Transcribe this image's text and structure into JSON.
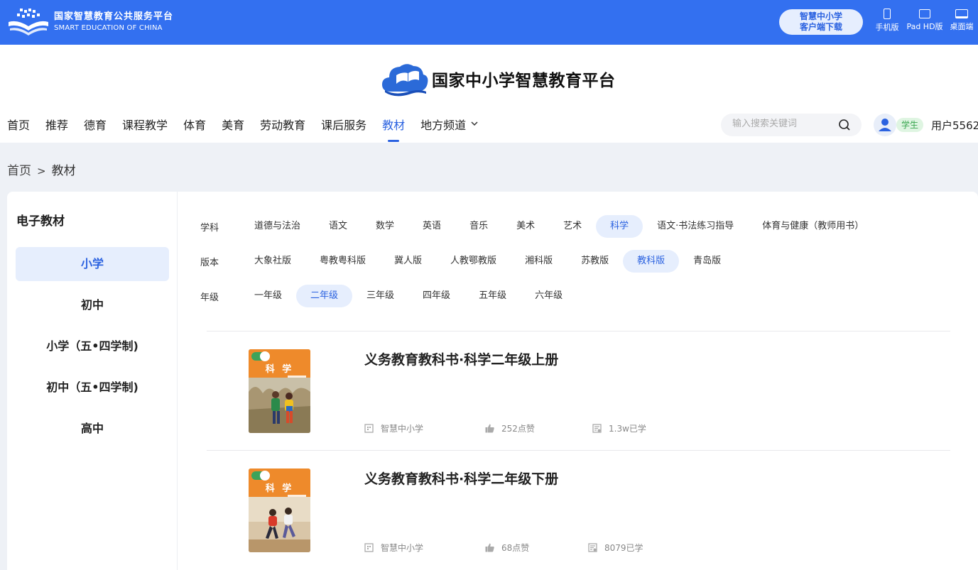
{
  "brand": {
    "name_cn": "国家智慧教育公共服务平台",
    "name_en": "SMART EDUCATION OF CHINA"
  },
  "topbar": {
    "download_line1": "智慧中小学",
    "download_line2": "客户端下载",
    "devices": [
      {
        "label": "手机版",
        "icon": "phone-icon"
      },
      {
        "label": "Pad HD版",
        "icon": "tablet-icon"
      },
      {
        "label": "桌面端",
        "icon": "desktop-icon"
      }
    ]
  },
  "site": {
    "title": "国家中小学智慧教育平台"
  },
  "nav": {
    "items": [
      {
        "label": "首页"
      },
      {
        "label": "推荐"
      },
      {
        "label": "德育"
      },
      {
        "label": "课程教学"
      },
      {
        "label": "体育"
      },
      {
        "label": "美育"
      },
      {
        "label": "劳动教育"
      },
      {
        "label": "课后服务"
      },
      {
        "label": "教材",
        "active": true
      },
      {
        "label": "地方频道"
      }
    ],
    "active_index": 8
  },
  "search": {
    "placeholder": "输入搜索关键词",
    "icon": "search-icon"
  },
  "user": {
    "role": "学生",
    "name": "用户5562"
  },
  "breadcrumb": {
    "home": "首页",
    "separator": ">",
    "current": "教材"
  },
  "sidebar": {
    "title": "电子教材",
    "items": [
      {
        "label": "小学",
        "active": true
      },
      {
        "label": "初中"
      },
      {
        "label": "小学（五•四学制)"
      },
      {
        "label": "初中（五•四学制)"
      },
      {
        "label": "高中"
      }
    ]
  },
  "filters": {
    "subject": {
      "label": "学科",
      "options": [
        "道德与法治",
        "语文",
        "数学",
        "英语",
        "音乐",
        "美术",
        "艺术",
        "科学",
        "语文·书法练习指导",
        "体育与健康（教师用书）"
      ],
      "selected": "科学"
    },
    "edition": {
      "label": "版本",
      "options": [
        "大象社版",
        "粤教粤科版",
        "冀人版",
        "人教鄂教版",
        "湘科版",
        "苏教版",
        "教科版",
        "青岛版"
      ],
      "selected": "教科版"
    },
    "grade": {
      "label": "年级",
      "options": [
        "一年级",
        "二年级",
        "三年级",
        "四年级",
        "五年级",
        "六年级"
      ],
      "selected": "二年级"
    }
  },
  "books": [
    {
      "title": "义务教育教科书·科学二年级上册",
      "cover_subject": "科 学",
      "source": "智慧中小学",
      "likes": "252点赞",
      "learned": "1.3w已学"
    },
    {
      "title": "义务教育教科书·科学二年级下册",
      "cover_subject": "科 学",
      "source": "智慧中小学",
      "likes": "68点赞",
      "learned": "8079已学"
    }
  ],
  "colors": {
    "topbar": "#3370f0",
    "accent": "#2b62e0",
    "selected_bg": "#e6eefd",
    "role_bg": "#dff5e2",
    "role_text": "#3aa650"
  }
}
